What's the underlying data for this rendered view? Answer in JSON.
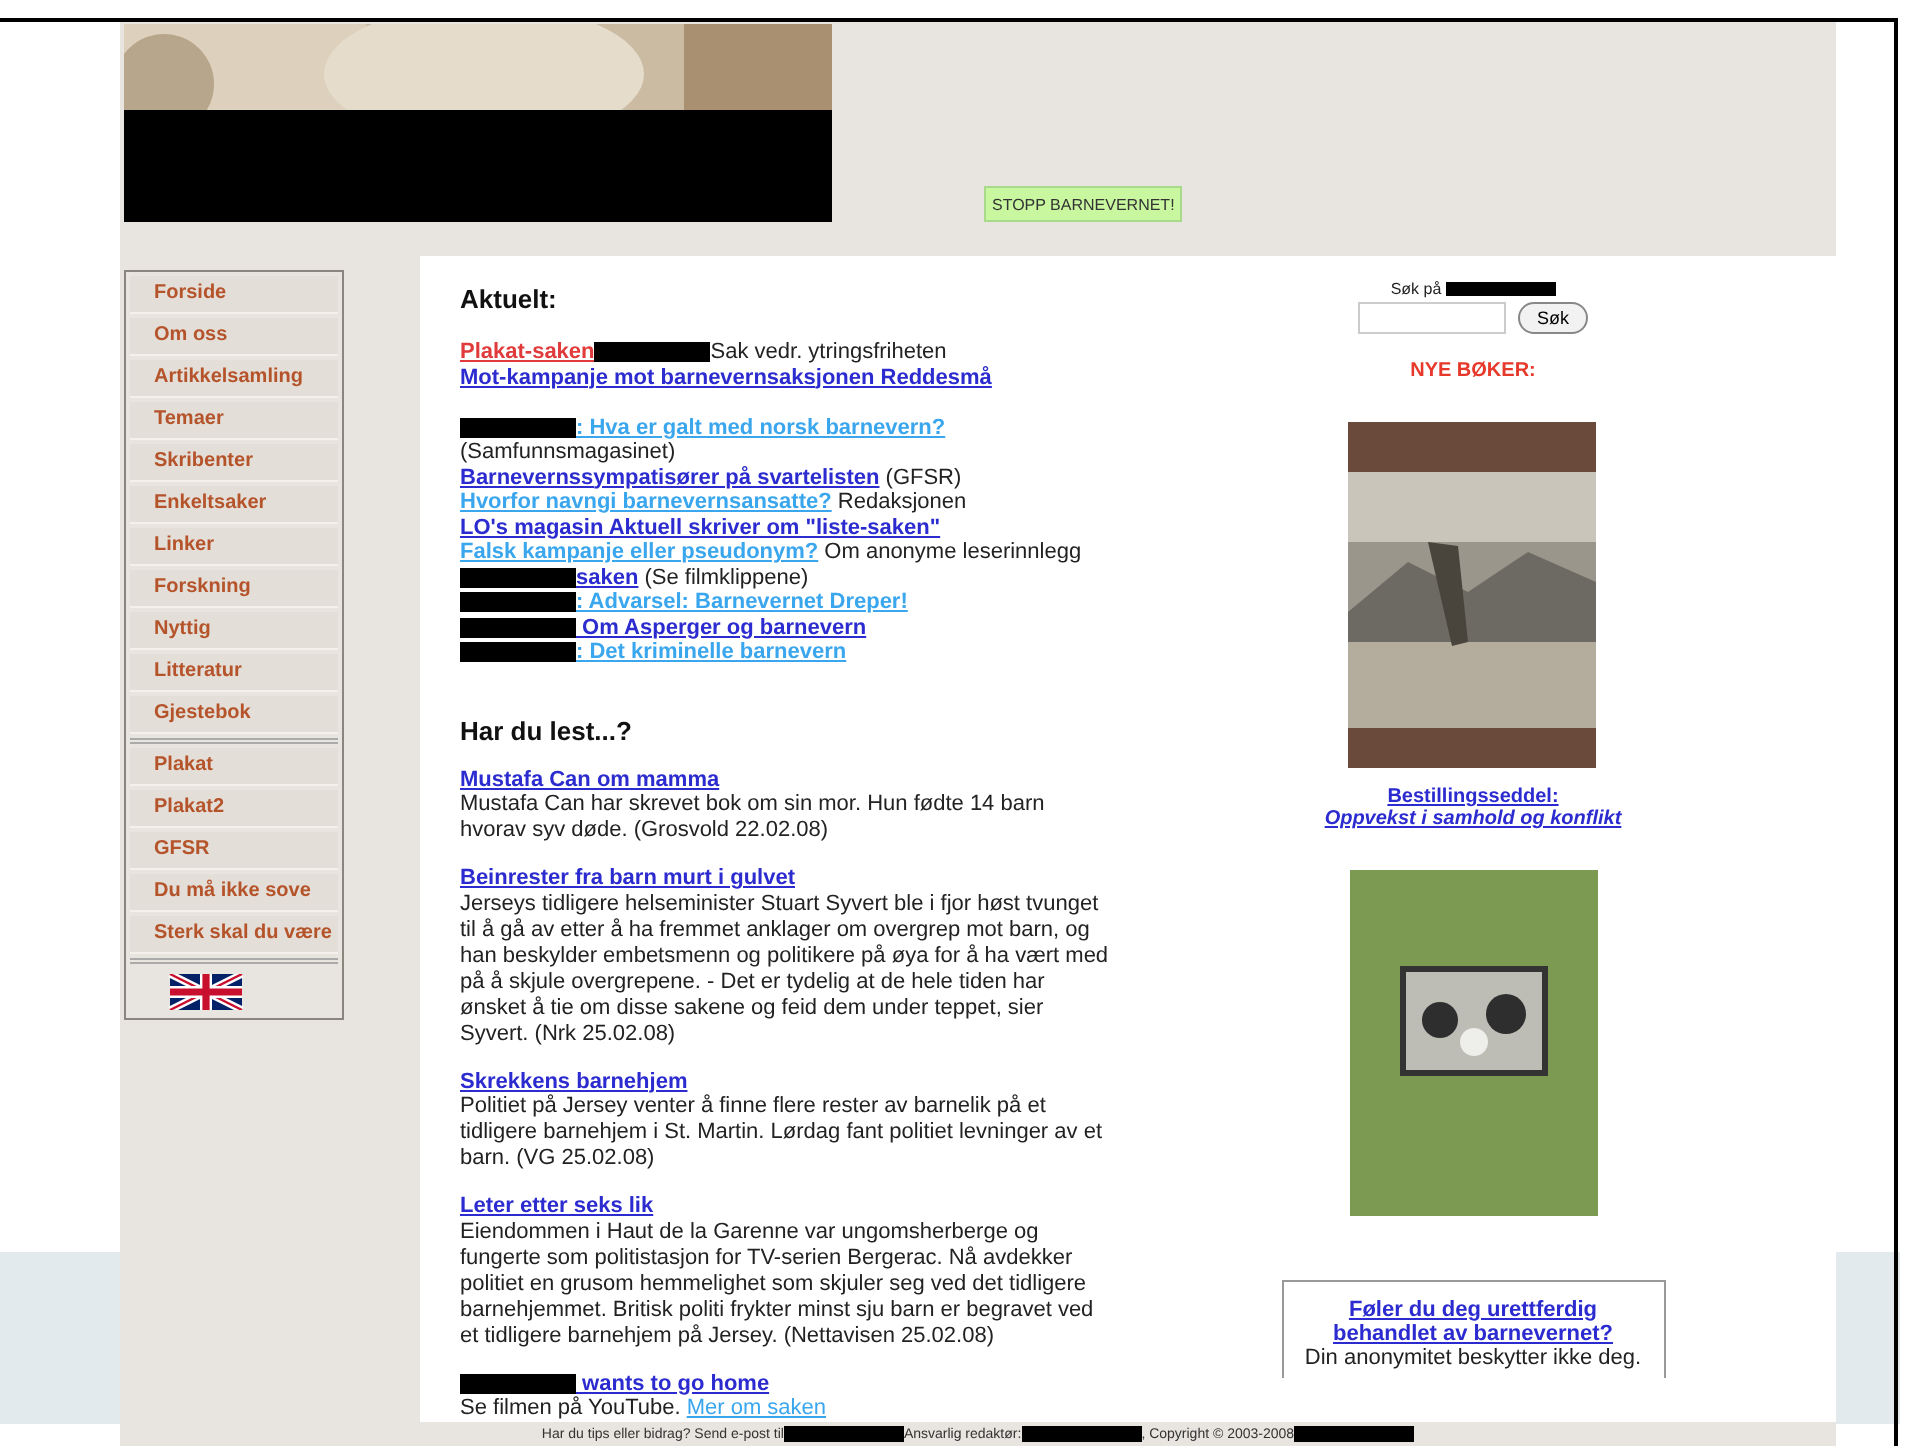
{
  "header": {
    "banner": {
      "kind": "picture"
    },
    "button": "STOPP BARNEVERNET!"
  },
  "nav": {
    "groups": [
      [
        "Forside",
        "Om oss",
        "Artikkelsamling",
        "Temaer",
        "Skribenter",
        "Enkeltsaker",
        "Linker",
        "Forskning",
        "Nyttig",
        "Litteratur",
        "Gjestebok"
      ],
      [
        "Plakat",
        "Plakat2",
        "GFSR",
        "Du må ikke sove",
        "Sterk skal du være"
      ]
    ]
  },
  "aktuelt": {
    "title": "Aktuelt:",
    "groups": [
      [
        [
          {
            "kind": "link",
            "text": "Plakat-saken",
            "color": "#e03a3a"
          },
          {
            "kind": "redacted"
          },
          {
            "kind": "text",
            "text": "Sak vedr. ytringsfriheten"
          }
        ],
        [
          {
            "kind": "link",
            "text": "Mot-kampanje mot barnevernsaksjonen Reddesmå",
            "color": "#2b2bd0"
          }
        ]
      ],
      [
        [
          {
            "kind": "redacted"
          },
          {
            "kind": "link",
            "text": ": Hva er galt med norsk barnevern?",
            "color": "#3aa6ee"
          }
        ],
        [
          {
            "kind": "text",
            "text": "(Samfunnsmagasinet)"
          }
        ],
        [
          {
            "kind": "link",
            "text": "Barnevernssympatisører på svartelisten",
            "color": "#2b2bd0"
          },
          {
            "kind": "text",
            "text": " (GFSR)"
          }
        ],
        [
          {
            "kind": "link",
            "text": "Hvorfor navngi barnevernsansatte?",
            "color": "#3aa6ee"
          },
          {
            "kind": "text",
            "text": " Redaksjonen"
          }
        ],
        [
          {
            "kind": "link",
            "text": "LO's magasin Aktuell skriver om \"liste-saken\"",
            "color": "#2b2bd0"
          }
        ],
        [
          {
            "kind": "link",
            "text": "Falsk kampanje eller pseudonym?",
            "color": "#3aa6ee"
          },
          {
            "kind": "text",
            "text": " Om anonyme leserinnlegg"
          }
        ],
        [
          {
            "kind": "redacted"
          },
          {
            "kind": "link",
            "text": "saken",
            "color": "#2b2bd0"
          },
          {
            "kind": "text",
            "text": " (Se filmklippene)"
          }
        ],
        [
          {
            "kind": "redacted"
          },
          {
            "kind": "link",
            "text": ": Advarsel: Barnevernet Dreper!",
            "color": "#3aa6ee"
          }
        ],
        [
          {
            "kind": "redacted"
          },
          {
            "kind": "link",
            "text": " Om Asperger og barnevern",
            "color": "#2b2bd0"
          }
        ],
        [
          {
            "kind": "redacted"
          },
          {
            "kind": "link",
            "text": ": Det kriminelle barnevern",
            "color": "#3aa6ee"
          }
        ]
      ]
    ]
  },
  "har_du_lest": {
    "title": "Har du lest...?",
    "articles": [
      {
        "title": [
          {
            "kind": "link",
            "text": "Mustafa Can om mamma",
            "color": "#2b2bd0"
          }
        ],
        "body": [
          {
            "kind": "text",
            "text": "Mustafa Can har skrevet bok om sin mor. Hun fødte 14 barn hvorav syv døde. (Grosvold 22.02.08)"
          }
        ]
      },
      {
        "title": [
          {
            "kind": "link",
            "text": "Beinrester fra barn murt i gulvet",
            "color": "#2b2bd0"
          }
        ],
        "body": [
          {
            "kind": "text",
            "text": "Jerseys tidligere helseminister Stuart Syvert ble i fjor høst tvunget til å gå av etter å ha fremmet anklager om overgrep mot barn, og han beskylder embetsmenn og politikere på øya for å ha vært med på å skjule overgrepene. - Det er tydelig at de hele tiden har ønsket å tie om disse sakene og feid dem under teppet, sier Syvert. (Nrk 25.02.08)"
          }
        ]
      },
      {
        "title": [
          {
            "kind": "link",
            "text": "Skrekkens barnehjem",
            "color": "#2b2bd0"
          }
        ],
        "body": [
          {
            "kind": "text",
            "text": "Politiet på Jersey venter å finne flere rester av barnelik på et tidligere barnehjem i St. Martin. Lørdag fant politiet levninger av et barn. (VG 25.02.08)"
          }
        ]
      },
      {
        "title": [
          {
            "kind": "link",
            "text": "Leter etter seks lik",
            "color": "#2b2bd0"
          }
        ],
        "body": [
          {
            "kind": "text",
            "text": "Eiendommen i Haut de la Garenne var ungomsherberge og fungerte som politistasjon for TV-serien Bergerac. Nå avdekker politiet en grusom hemmelighet som skjuler seg ved det tidligere barnehjemmet. Britisk politi frykter minst sju barn er begravet ved et tidligere barnehjem på Jersey. (Nettavisen 25.02.08)"
          }
        ]
      },
      {
        "title": [
          {
            "kind": "redacted"
          },
          {
            "kind": "link",
            "text": " wants to go home",
            "color": "#2b2bd0"
          }
        ],
        "body": [
          {
            "kind": "text",
            "text": "Se filmen på YouTube. "
          },
          {
            "kind": "link",
            "text": "Mer om saken",
            "color": "#3aa6ee"
          }
        ]
      }
    ]
  },
  "sidebar_right": {
    "search_label": [
      {
        "kind": "text",
        "text": "Søk på "
      },
      {
        "kind": "redacted"
      }
    ],
    "search_button": "Søk",
    "books_title": "NYE BØKER:",
    "books": [
      {
        "kind": "picture",
        "links": [
          "Bestillingsseddel:",
          "Oppvekst i samhold og konflikt"
        ]
      },
      {
        "kind": "picture"
      }
    ],
    "notice": {
      "link": "Føler du deg urettferdig behandlet av barnevernet?",
      "text": "Din anonymitet beskytter ikke deg."
    }
  },
  "footer": [
    {
      "kind": "text",
      "text": "Har du tips eller bidrag? Send e-post til"
    },
    {
      "kind": "redacted"
    },
    {
      "kind": "text",
      "text": " Ansvarlig redaktør: "
    },
    {
      "kind": "redacted"
    },
    {
      "kind": "text",
      "text": ", Copyright © 2003-2008"
    },
    {
      "kind": "redacted"
    }
  ]
}
